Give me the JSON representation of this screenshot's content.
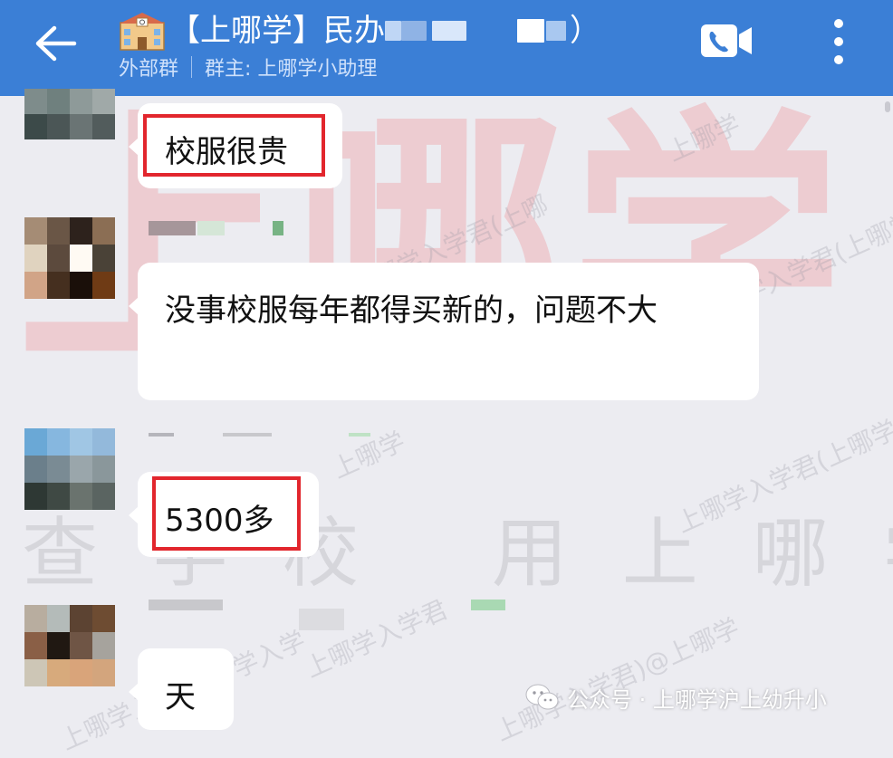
{
  "header": {
    "title": "【上哪学】民办",
    "title_end": "）",
    "subtitle_group": "外部群",
    "subtitle_owner": "群主: 上哪学小助理",
    "accent": "#3b7fd6"
  },
  "icons": [
    "back-arrow-icon",
    "school-icon",
    "video-call-icon",
    "more-icon",
    "wechat-icon"
  ],
  "watermark": {
    "big": "上哪学",
    "line": "查学校 用上哪学",
    "diag1": "上哪学",
    "diag2": "上哪学入学君(上哪学",
    "diag3": "上哪学入学君(上哪",
    "diag4": "上哪学入学君(上哪学",
    "diag5": "上哪学",
    "diag6": "上哪学入学君",
    "diag7": "上哪学入学君",
    "diag8": "学入学",
    "diag9": "上哪学入学君)@上哪学"
  },
  "messages": [
    {
      "text": "校服很贵"
    },
    {
      "text": "没事校服每年都得买新的，问题不大"
    },
    {
      "text": "5300多"
    },
    {
      "text": "天"
    }
  ],
  "footer": {
    "text": "公众号 · 上哪学沪上幼升小"
  }
}
